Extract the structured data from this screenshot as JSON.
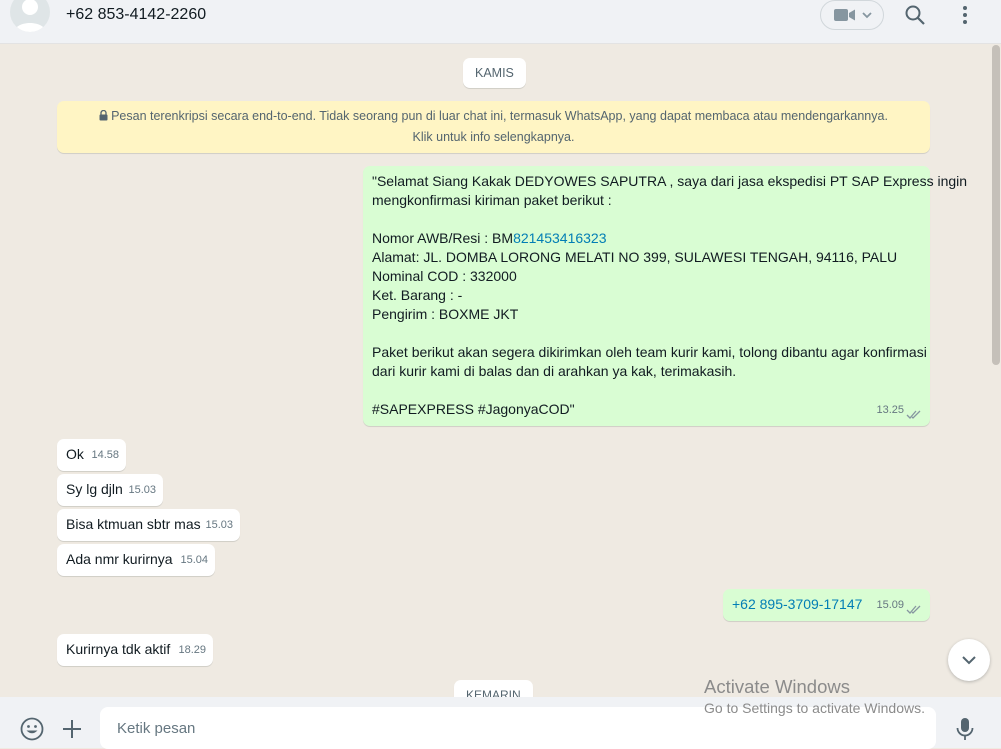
{
  "header": {
    "contact_name": "+62 853-4142-2260",
    "icons": [
      "avatar-placeholder",
      "video-camera-icon",
      "chevron-down-icon",
      "search-icon",
      "menu-icon"
    ]
  },
  "chat": {
    "date_chip_1": "KAMIS",
    "date_chip_2": "KEMARIN",
    "encryption_notice": {
      "line1": "Pesan terenkripsi secara end-to-end. Tidak seorang pun di luar chat ini, termasuk WhatsApp, yang dapat membaca atau mendengarkannya.",
      "line2": "Klik untuk info selengkapnya."
    },
    "outgoing_main": {
      "line1": "\"Selamat Siang Kakak DEDYOWES SAPUTRA , saya dari jasa ekspedisi PT SAP Express ingin",
      "line2": "mengkonfirmasi kiriman paket berikut :",
      "awb_label": "Nomor AWB/Resi : BM",
      "awb_link": "821453416323",
      "alamat": "Alamat: JL. DOMBA LORONG MELATI NO 399, SULAWESI TENGAH, 94116, PALU",
      "nominal": "Nominal COD : 332000",
      "barang": "Ket. Barang : -",
      "pengirim": "Pengirim : BOXME JKT",
      "para1": "Paket berikut akan segera dikirimkan oleh team kurir kami, tolong dibantu agar konfirmasi",
      "para2": "dari kurir kami di balas dan di arahkan ya kak, terimakasih.",
      "tags": "#SAPEXPRESS #JagonyaCOD\"",
      "time": "13.25"
    },
    "incoming": [
      {
        "text": "Ok",
        "time": "14.58"
      },
      {
        "text": "Sy lg djln",
        "time": "15.03"
      },
      {
        "text": "Bisa ktmuan sbtr mas",
        "time": "15.03"
      },
      {
        "text": "Ada nmr kurirnya",
        "time": "15.04"
      }
    ],
    "outgoing_phone": {
      "text": "+62 895-3709-17147",
      "time": "15.09"
    },
    "incoming_last": {
      "text": "Kurirnya tdk aktif",
      "time": "18.29"
    }
  },
  "footer": {
    "input_placeholder": "Ketik pesan"
  },
  "watermark": {
    "line1": "Activate Windows",
    "line2": "Go to Settings to activate Windows."
  },
  "colors": {
    "outgoing_bubble": "#d9fdd3",
    "incoming_bubble": "#ffffff",
    "chat_background": "#efeae2",
    "encryption_banner": "#fff5c4",
    "link": "#027eb5",
    "header_bg": "#f0f2f5"
  }
}
